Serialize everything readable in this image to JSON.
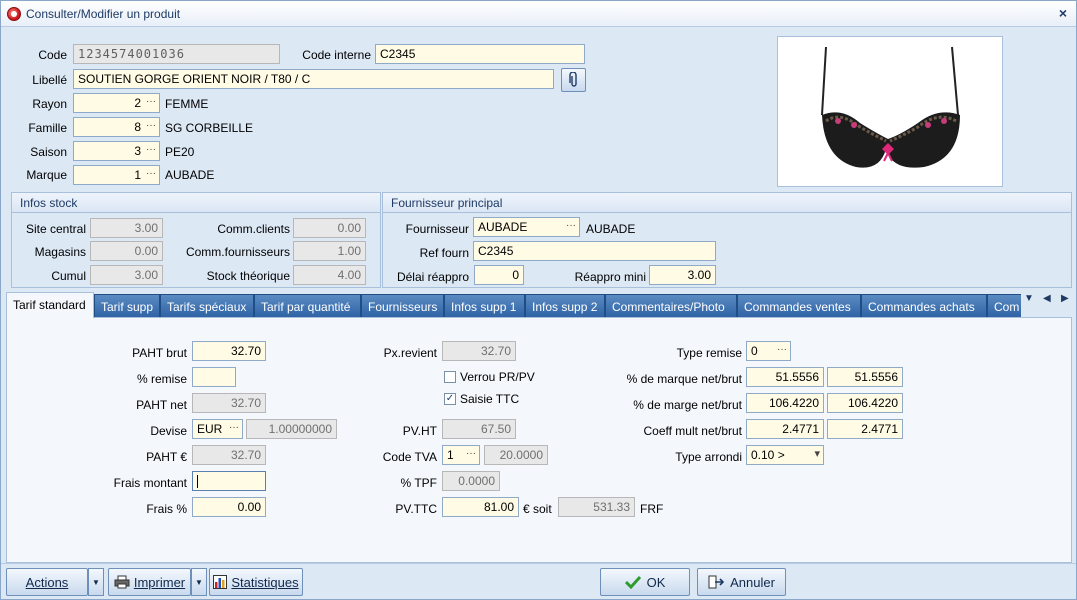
{
  "window": {
    "title": "Consulter/Modifier un produit",
    "close_symbol": "×"
  },
  "header": {
    "code_label": "Code",
    "code_value": "1234574001036",
    "code_interne_label": "Code interne",
    "code_interne_value": "C2345",
    "libelle_label": "Libellé",
    "libelle_value": "SOUTIEN GORGE ORIENT NOIR / T80 / C",
    "rayon_label": "Rayon",
    "rayon_value": "2",
    "rayon_name": "FEMME",
    "famille_label": "Famille",
    "famille_value": "8",
    "famille_name": "SG CORBEILLE",
    "saison_label": "Saison",
    "saison_value": "3",
    "saison_name": "PE20",
    "marque_label": "Marque",
    "marque_value": "1",
    "marque_name": "AUBADE",
    "dots": "···"
  },
  "stock": {
    "title": "Infos stock",
    "site_central_label": "Site central",
    "site_central_value": "3.00",
    "magasins_label": "Magasins",
    "magasins_value": "0.00",
    "cumul_label": "Cumul",
    "cumul_value": "3.00",
    "comm_clients_label": "Comm.clients",
    "comm_clients_value": "0.00",
    "comm_fourn_label": "Comm.fournisseurs",
    "comm_fourn_value": "1.00",
    "stock_theo_label": "Stock théorique",
    "stock_theo_value": "4.00"
  },
  "supplier": {
    "title": "Fournisseur principal",
    "fournisseur_label": "Fournisseur",
    "fournisseur_value": "AUBADE",
    "fournisseur_name": "AUBADE",
    "ref_label": "Ref fourn",
    "ref_value": "C2345",
    "delai_label": "Délai réappro",
    "delai_value": "0",
    "reappro_label": "Réappro mini",
    "reappro_value": "3.00"
  },
  "tabs": [
    {
      "label": "Tarif standard"
    },
    {
      "label": "Tarif supp"
    },
    {
      "label": "Tarifs spéciaux"
    },
    {
      "label": "Tarif par quantité"
    },
    {
      "label": "Fournisseurs"
    },
    {
      "label": "Infos supp 1"
    },
    {
      "label": "Infos supp 2"
    },
    {
      "label": "Commentaires/Photo"
    },
    {
      "label": "Commandes ventes"
    },
    {
      "label": "Commandes achats"
    },
    {
      "label": "Com"
    }
  ],
  "tab_nav": {
    "dropdown": "▼",
    "prev": "◀",
    "next": "▶"
  },
  "tarif": {
    "paht_brut_label": "PAHT brut",
    "paht_brut_value": "32.70",
    "remise_label": "% remise",
    "remise_value": "",
    "paht_net_label": "PAHT net",
    "paht_net_value": "32.70",
    "devise_label": "Devise",
    "devise_value": "EUR",
    "devise_rate": "1.00000000",
    "paht_eur_label": "PAHT €",
    "paht_eur_value": "32.70",
    "frais_montant_label": "Frais montant",
    "frais_montant_value": "",
    "frais_pct_label": "Frais %",
    "frais_pct_value": "0.00",
    "px_revient_label": "Px.revient",
    "px_revient_value": "32.70",
    "verrou_label": "Verrou PR/PV",
    "verrou_checked": "",
    "saisie_ttc_label": "Saisie TTC",
    "saisie_ttc_checked": "✓",
    "pvht_label": "PV.HT",
    "pvht_value": "67.50",
    "code_tva_label": "Code TVA",
    "code_tva_value": "1",
    "tva_rate": "20.0000",
    "tpf_label": "% TPF",
    "tpf_value": "0.0000",
    "pvttc_label": "PV.TTC",
    "pvttc_value": "81.00",
    "soit_label": "€ soit",
    "frf_value": "531.33",
    "frf_label": "FRF",
    "type_remise_label": "Type remise",
    "type_remise_value": "0",
    "marque_nb_label": "% de marque net/brut",
    "marque_net": "51.5556",
    "marque_brut": "51.5556",
    "marge_nb_label": "% de marge net/brut",
    "marge_net": "106.4220",
    "marge_brut": "106.4220",
    "coeff_label": "Coeff mult net/brut",
    "coeff_net": "2.4771",
    "coeff_brut": "2.4771",
    "arrondi_label": "Type arrondi",
    "arrondi_value": "0.10 >",
    "arrondi_arrow": "▾"
  },
  "buttons": {
    "actions": "Actions",
    "imprimer": "Imprimer",
    "statistiques": "Statistiques",
    "ok": "OK",
    "annuler": "Annuler",
    "arrow": "▼"
  },
  "colors": {
    "accent_tab": "#2f63a5",
    "field_yellow": "#fffbe5",
    "ok_check": "#2e9b2e"
  }
}
